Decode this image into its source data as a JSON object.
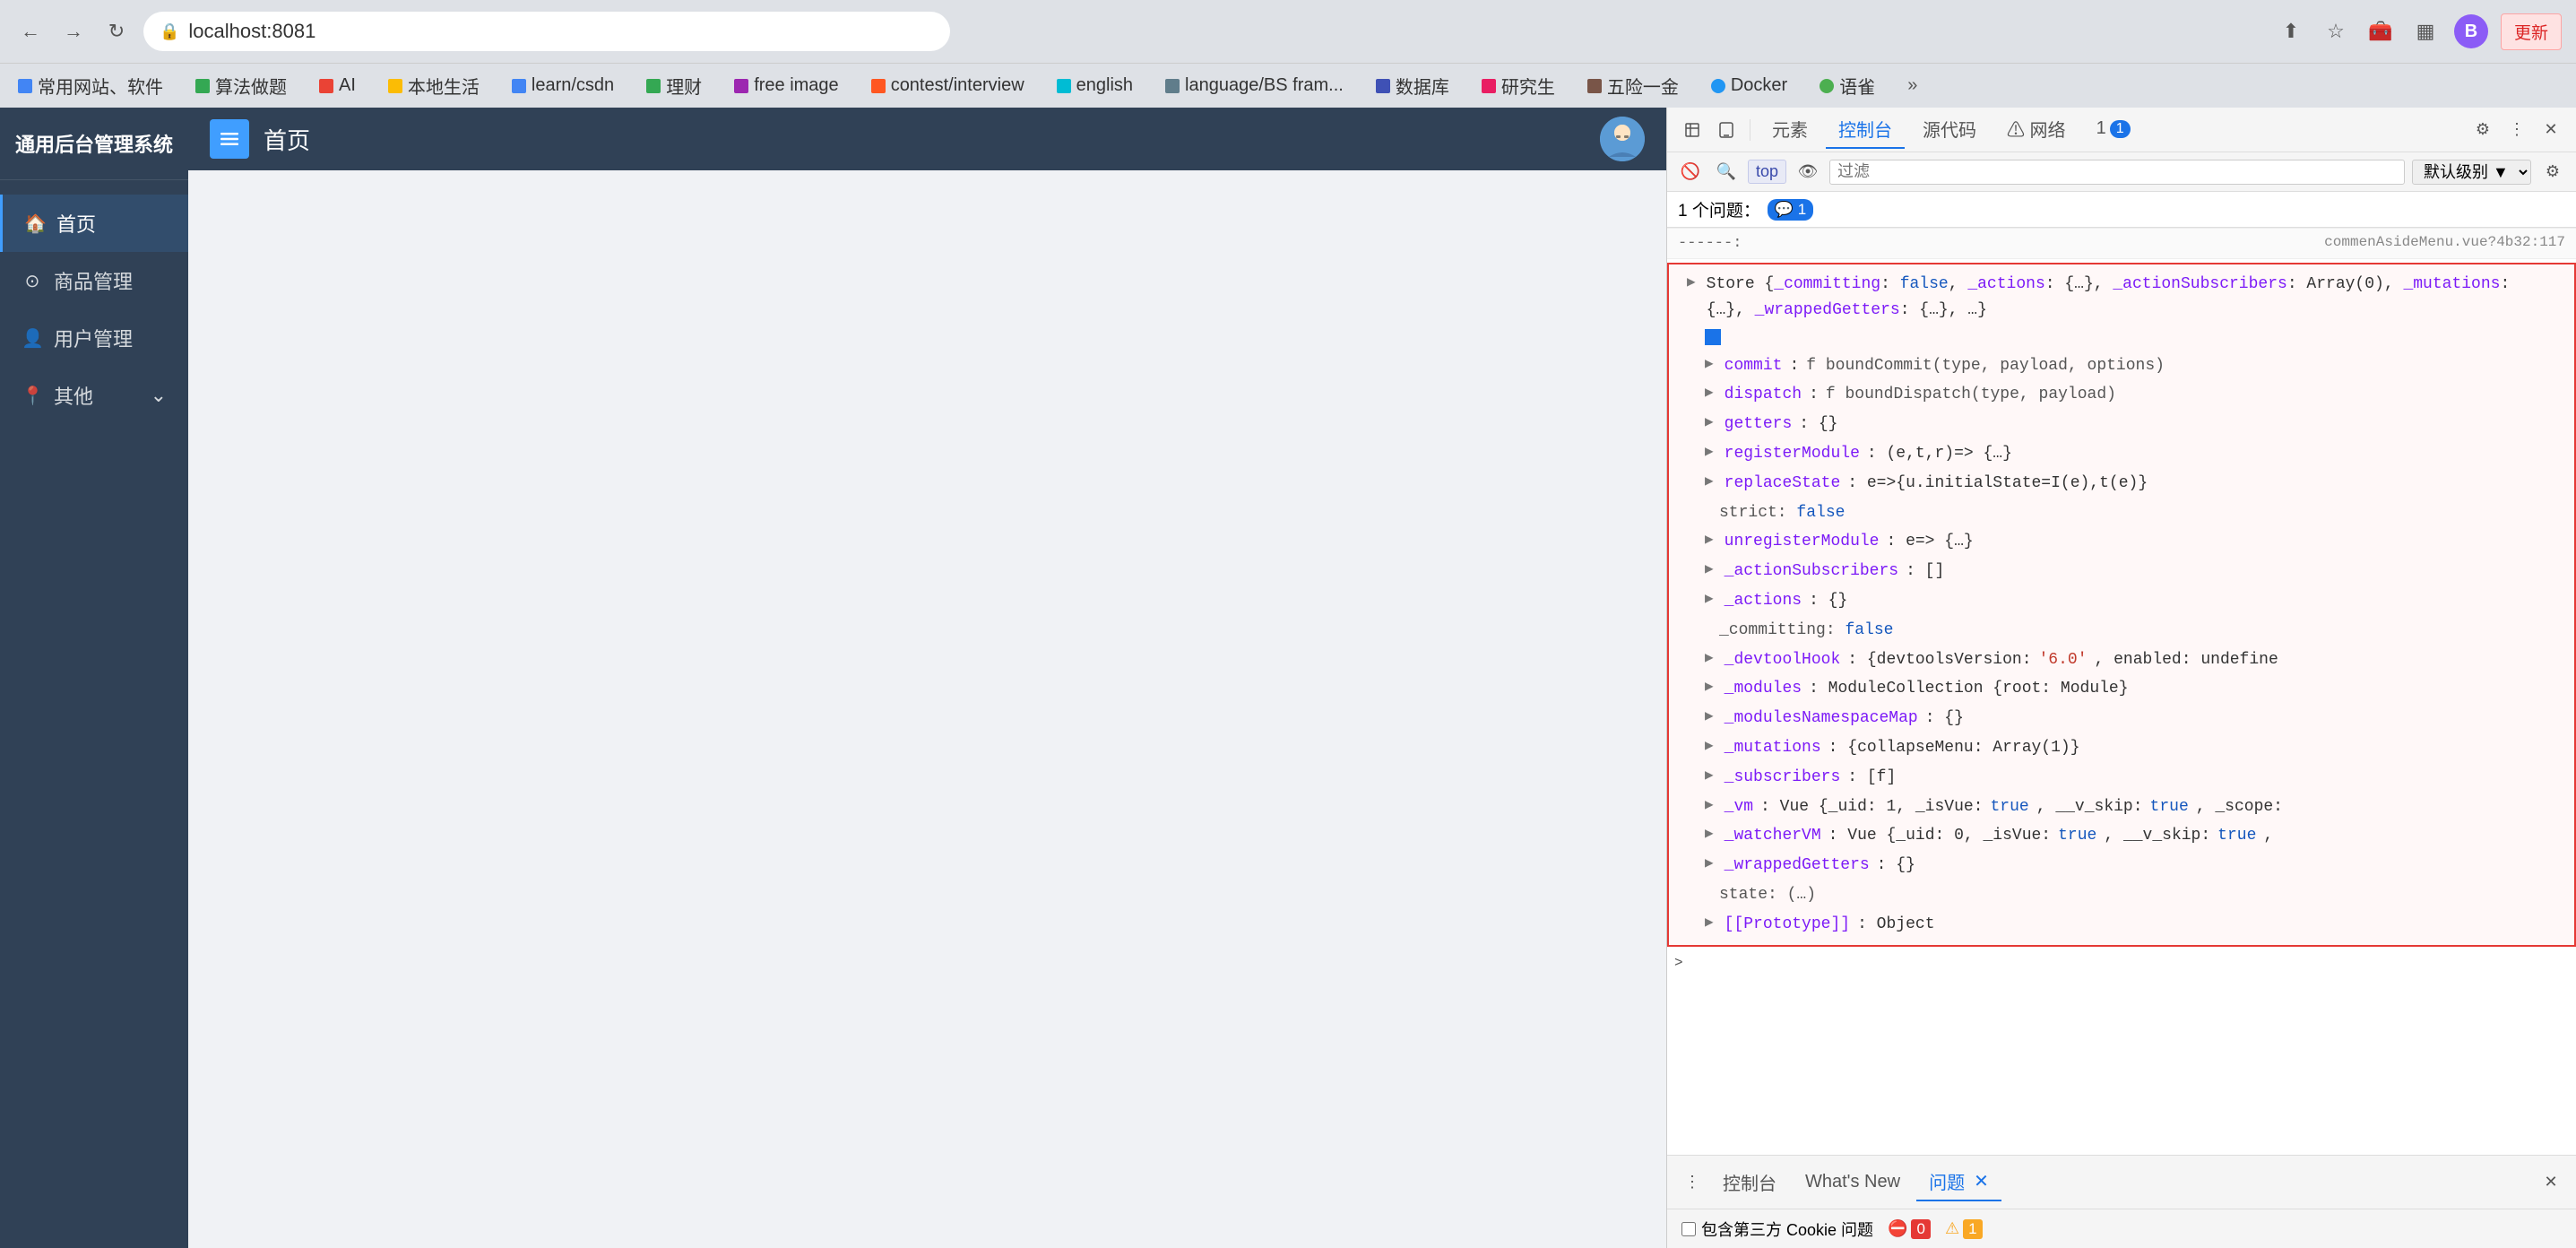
{
  "browser": {
    "url": "localhost:8081",
    "update_btn": "更新",
    "bookmarks": [
      {
        "label": "常用网站、软件",
        "icon": "📋"
      },
      {
        "label": "算法做题",
        "icon": "📋"
      },
      {
        "label": "AI",
        "icon": "📋"
      },
      {
        "label": "本地生活",
        "icon": "📋"
      },
      {
        "label": "learn/csdn",
        "icon": "📋"
      },
      {
        "label": "理财",
        "icon": "📋"
      },
      {
        "label": "free image",
        "icon": "📋"
      },
      {
        "label": "contest/interview",
        "icon": "📋"
      },
      {
        "label": "english",
        "icon": "📋"
      },
      {
        "label": "language/BS fram...",
        "icon": "📋"
      },
      {
        "label": "数据库",
        "icon": "📋"
      },
      {
        "label": "研究生",
        "icon": "📋"
      },
      {
        "label": "五险一金",
        "icon": "📋"
      },
      {
        "label": "Docker",
        "icon": "🌐"
      },
      {
        "label": "语雀",
        "icon": "🌿"
      }
    ]
  },
  "sidebar": {
    "logo": "通用后台管理系统",
    "menu_items": [
      {
        "label": "首页",
        "icon": "🏠",
        "active": true
      },
      {
        "label": "商品管理",
        "icon": "⊙"
      },
      {
        "label": "用户管理",
        "icon": "👤"
      },
      {
        "label": "其他",
        "icon": "📍",
        "has_arrow": true
      }
    ]
  },
  "page_header": {
    "title": "首页"
  },
  "devtools": {
    "tabs": [
      {
        "label": "元素"
      },
      {
        "label": "控制台",
        "active": true
      },
      {
        "label": "源代码"
      },
      {
        "label": "⚠ 网络"
      },
      {
        "label": "1",
        "badge": true
      }
    ],
    "top_label": "top",
    "filter_placeholder": "过滤",
    "level_label": "默认级别",
    "issues_count": "1 个问题：",
    "issues_badge": "1",
    "separator_text": "------:",
    "source_ref": "commenAsideMenu.vue?4b32:117",
    "console_lines": [
      {
        "indent": 0,
        "expand": true,
        "text": "Store {_committing: false, _actions: {…}, _actionSubscribers: Array(0), _mutations: {…}, _wrappedGetters: {…}, …}",
        "type": "error_top"
      },
      {
        "indent": 1,
        "expand": true,
        "key": "commit",
        "value": "f boundCommit(type, payload, options)"
      },
      {
        "indent": 1,
        "expand": true,
        "key": "dispatch",
        "value": "f boundDispatch(type, payload)"
      },
      {
        "indent": 1,
        "expand": true,
        "key": "getters",
        "value": "{}"
      },
      {
        "indent": 1,
        "expand": true,
        "key": "registerModule",
        "value": "(e,t,r)=> {…}"
      },
      {
        "indent": 1,
        "expand": true,
        "key": "replaceState",
        "value": "e=>{u.initialState=I(e),t(e)}"
      },
      {
        "indent": 1,
        "plain": "strict: false"
      },
      {
        "indent": 1,
        "expand": true,
        "key": "unregisterModule",
        "value": "e=> {…}"
      },
      {
        "indent": 1,
        "expand": true,
        "key": "_actionSubscribers",
        "value": "[]"
      },
      {
        "indent": 1,
        "expand": true,
        "key": "_actions",
        "value": "{}"
      },
      {
        "indent": 1,
        "plain": "_committing: false",
        "value_type": "bool"
      },
      {
        "indent": 1,
        "expand": true,
        "key": "_devtoolHook",
        "value": "{devtoolsVersion: '6.0', enabled: undefine"
      },
      {
        "indent": 1,
        "expand": true,
        "key": "_modules",
        "value": "ModuleCollection {root: Module}"
      },
      {
        "indent": 1,
        "expand": true,
        "key": "_modulesNamespaceMap",
        "value": "{}"
      },
      {
        "indent": 1,
        "expand": true,
        "key": "_mutations",
        "value": "{collapseMenu: Array(1)}"
      },
      {
        "indent": 1,
        "expand": true,
        "key": "_subscribers",
        "value": "[f]"
      },
      {
        "indent": 1,
        "expand": true,
        "key": "_vm",
        "value": "Vue {_uid: 1, _isVue: true, __v_skip: true, _scope:"
      },
      {
        "indent": 1,
        "expand": true,
        "key": "_watcherVM",
        "value": "Vue {_uid: 0, _isVue: true, __v_skip: true,"
      },
      {
        "indent": 1,
        "expand": true,
        "key": "_wrappedGetters",
        "value": "{}"
      },
      {
        "indent": 1,
        "plain": "state:  (…)"
      },
      {
        "indent": 1,
        "expand": true,
        "key": "[[Prototype]]",
        "value": "Object"
      }
    ],
    "bottom_tabs": [
      {
        "label": "控制台"
      },
      {
        "label": "What's New"
      },
      {
        "label": "问题",
        "active": true,
        "closeable": true
      }
    ],
    "third_party_label": "包含第三方 Cookie 问题",
    "error_count": "0",
    "warn_count": "1"
  }
}
